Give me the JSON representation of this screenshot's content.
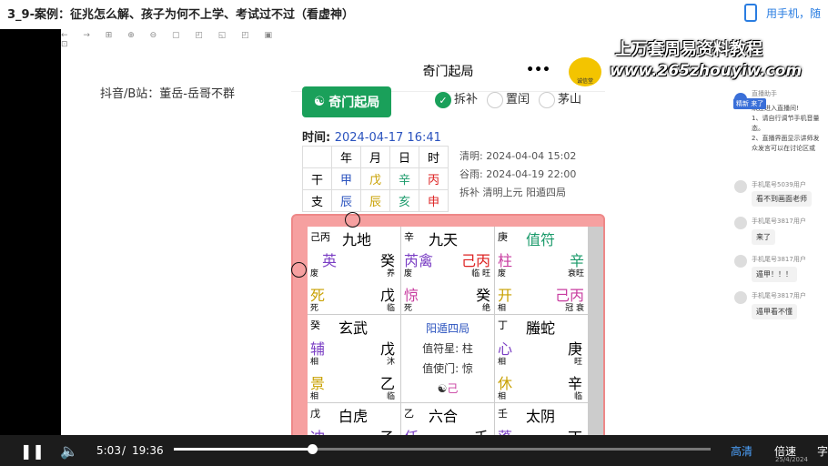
{
  "title": "3_9-案例：征兆怎么解、孩子为何不上学、考试过不过（看虚神）",
  "phone_link": "用手机，随",
  "toolbar": "← → ⊞ ⊕ ⊖ ▢ ◰ ◱ ◰ ▣ ⊡",
  "douyin": "抖音/B站：董岳-岳哥不群",
  "watermark": {
    "line1": "上万套周易资料教程",
    "line2": "www.265zhouyiw.com"
  },
  "app": {
    "title": "奇门起局",
    "dots": "•••",
    "logo": "诚信堂",
    "button": "奇门起局",
    "opt1": "拆补",
    "opt2": "置闰",
    "opt3": "茅山",
    "time_label": "时间: ",
    "time_value": "2024-04-17 16:41",
    "gz": {
      "h": [
        "年",
        "月",
        "日",
        "时"
      ],
      "gan_label": "干",
      "zhi_label": "支",
      "gan": [
        "甲",
        "戊",
        "辛",
        "丙"
      ],
      "zhi": [
        "辰",
        "辰",
        "亥",
        "申"
      ]
    },
    "info": [
      "清明: 2024-04-04 15:02",
      "谷雨: 2024-04-19 22:00",
      "拆补  清明上元  阳遁四局"
    ]
  },
  "center": {
    "ju": "阳遁四局",
    "zhifu": "值符星: 柱",
    "zhishi": "值使门: 惊",
    "ji": "己"
  },
  "cells": [
    {
      "tl": "己丙",
      "god": "九地",
      "c": "癸",
      "star": "英",
      "r1": "癸",
      "sw": "废",
      "sw2": "养",
      "door": "死",
      "r2": "戊",
      "d1": "死",
      "d2": "临"
    },
    {
      "tl": "辛",
      "god": "九天",
      "c": "己丙",
      "star": "芮禽",
      "r1": "己丙",
      "sw": "废",
      "sw2": "临 旺",
      "door": "惊",
      "r2": "癸",
      "d1": "死",
      "d2": "绝"
    },
    {
      "tl": "庚",
      "god": "值符",
      "c": "辛",
      "star": "柱",
      "r1": "辛",
      "sw": "废",
      "sw2": "衰旺",
      "door": "开",
      "r2": "己丙",
      "d1": "相",
      "d2": "冠 衰"
    },
    {
      "tl": "癸",
      "god": "玄武",
      "c": "戊",
      "star": "辅",
      "r1": "戊",
      "sw": "相",
      "sw2": "沐",
      "door": "景",
      "r2": "乙",
      "d1": "相",
      "d2": "临"
    },
    {
      "tl": "丁",
      "god": "螣蛇",
      "c": "庚",
      "star": "心",
      "r1": "庚",
      "sw": "相",
      "sw2": "旺",
      "door": "休",
      "r2": "辛",
      "d1": "相",
      "d2": "临"
    },
    {
      "tl": "戊",
      "god": "白虎",
      "c": "乙",
      "star": "冲",
      "r1": "乙"
    },
    {
      "tl": "乙",
      "god": "六合",
      "c": "壬",
      "star": "任",
      "r1": "壬"
    },
    {
      "tl": "壬",
      "god": "太阴",
      "c": "丁",
      "star": "蓬",
      "r1": "丁"
    }
  ],
  "chat": {
    "host": "直播助手",
    "welcome": "欢迎进入直播间!",
    "l1": "1、请自行调节手机音量",
    "l1b": "态。",
    "l2": "2、直播界面显示讲师发",
    "l2b": "众发言可以在讨论区或",
    "u1": "手机尾号5039用户",
    "m1": "看不到画面老师",
    "u2": "手机尾号3817用户",
    "m2": "来了",
    "u3": "手机尾号3817用户",
    "m3": "遁甲！！！",
    "u4": "手机尾号3817用户",
    "m4": "遁甲看不懂",
    "tag": "精新 来了"
  },
  "player": {
    "current": "5:03",
    "sep": "/",
    "total": "19:36",
    "quality": "高清",
    "speed": "倍速",
    "sub": "字",
    "date": "25/4/2024"
  }
}
